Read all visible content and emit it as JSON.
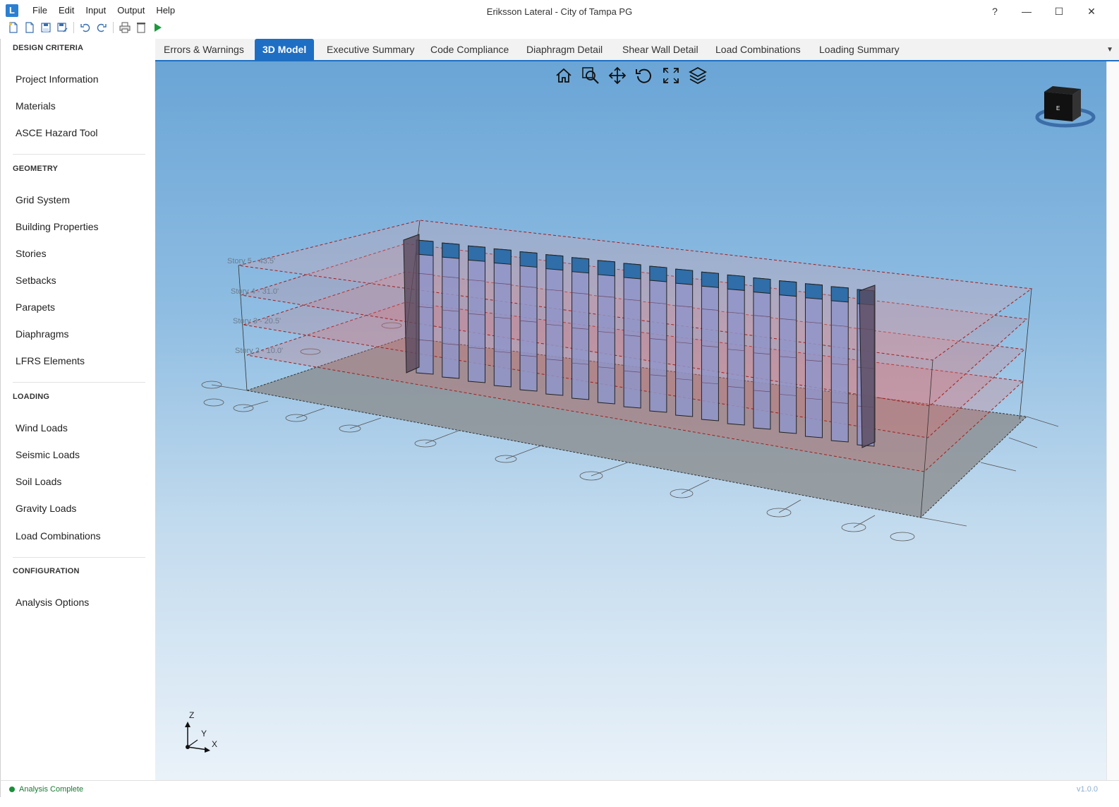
{
  "app": {
    "logo_letter": "L",
    "title": "Eriksson Lateral - City of Tampa PG",
    "menu": [
      "File",
      "Edit",
      "Input",
      "Output",
      "Help"
    ],
    "window_controls": {
      "help": "?",
      "minimize": "—",
      "maximize": "☐",
      "close": "✕"
    }
  },
  "toolbar": {
    "icons": [
      "new-file-icon",
      "open-file-icon",
      "save-icon",
      "save-as-icon",
      "undo-icon",
      "redo-icon",
      "print-icon",
      "delete-icon",
      "run-icon"
    ]
  },
  "sidebar": {
    "sections": [
      {
        "title": "DESIGN CRITERIA",
        "items": [
          "Project Information",
          "Materials",
          "ASCE Hazard Tool"
        ]
      },
      {
        "title": "GEOMETRY",
        "items": [
          "Grid System",
          "Building Properties",
          "Stories",
          "Setbacks",
          "Parapets",
          "Diaphragms",
          "LFRS Elements"
        ]
      },
      {
        "title": "LOADING",
        "items": [
          "Wind Loads",
          "Seismic Loads",
          "Soil Loads",
          "Gravity Loads",
          "Load Combinations"
        ]
      },
      {
        "title": "CONFIGURATION",
        "items": [
          "Analysis Options"
        ]
      }
    ]
  },
  "tabs": [
    {
      "label": "Errors & Warnings",
      "active": false
    },
    {
      "label": "3D Model",
      "active": true
    },
    {
      "label": "Executive Summary",
      "active": false
    },
    {
      "label": "Code Compliance",
      "active": false
    },
    {
      "label": "Diaphragm Detail",
      "active": false
    },
    {
      "label": "Shear Wall Detail",
      "active": false
    },
    {
      "label": "Load Combinations",
      "active": false
    },
    {
      "label": "Loading Summary",
      "active": false
    }
  ],
  "viewport": {
    "tools": [
      "home-icon",
      "zoom-window-icon",
      "pan-icon",
      "rotate-icon",
      "fit-extents-icon",
      "layers-icon"
    ],
    "view_cube_face": "E",
    "axis_triad": {
      "z": "Z",
      "y": "Y",
      "x": "X"
    },
    "story_labels": [
      "Story 5 - 43.5'",
      "Story 4 - 31.0'",
      "Story 3 - 20.5'",
      "Story 2 - 10.0'"
    ],
    "colors": {
      "wall_top": "#2f6ea8",
      "wall_body": "#8f95c9",
      "floor_plate": "#e06d6d",
      "ground": "#8a8a8a"
    }
  },
  "status": {
    "text": "Analysis Complete",
    "version": "v1.0.0",
    "color": "#1a8f3a"
  }
}
